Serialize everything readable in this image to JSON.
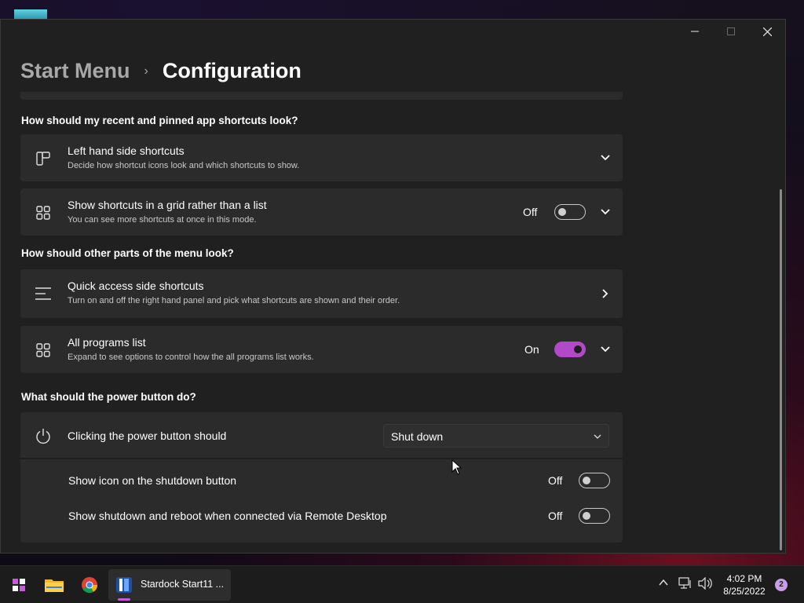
{
  "window": {
    "controls": {
      "minimize": "—",
      "maximize": "☐",
      "close": "✕"
    }
  },
  "breadcrumb": {
    "parent": "Start Menu",
    "separator": "›",
    "current": "Configuration"
  },
  "sections": {
    "shortcuts_title": "How should my recent and pinned app shortcuts look?",
    "menu_title": "How should other parts of the menu look?",
    "power_title": "What should the power button do?"
  },
  "cards": {
    "left_hand": {
      "title": "Left hand side shortcuts",
      "desc": "Decide how shortcut icons look and which shortcuts to show.",
      "icon": "layout-icon"
    },
    "grid": {
      "title": "Show shortcuts in a grid rather than a list",
      "desc": "You can see more shortcuts at once in this mode.",
      "state": "Off",
      "icon": "grid-icon"
    },
    "quick_access": {
      "title": "Quick access side shortcuts",
      "desc": "Turn on and off the right hand panel and pick what shortcuts are shown and their order.",
      "icon": "list-icon"
    },
    "all_programs": {
      "title": "All programs list",
      "desc": "Expand to see options to control how the all programs list works.",
      "state": "On",
      "icon": "grid-icon"
    },
    "power": {
      "title": "Clicking the power button should",
      "dropdown_value": "Shut down",
      "icon": "power-icon",
      "subrows": [
        {
          "label": "Show icon on the shutdown button",
          "state": "Off"
        },
        {
          "label": "Show shutdown and reboot when connected via Remote Desktop",
          "state": "Off"
        }
      ]
    }
  },
  "taskbar": {
    "app_label": "Stardock Start11 ...",
    "time": "4:02 PM",
    "date": "8/25/2022",
    "notifications": "2"
  },
  "colors": {
    "accent": "#b249c8",
    "card_bg": "#2b2b2b",
    "window_bg": "#202020"
  }
}
